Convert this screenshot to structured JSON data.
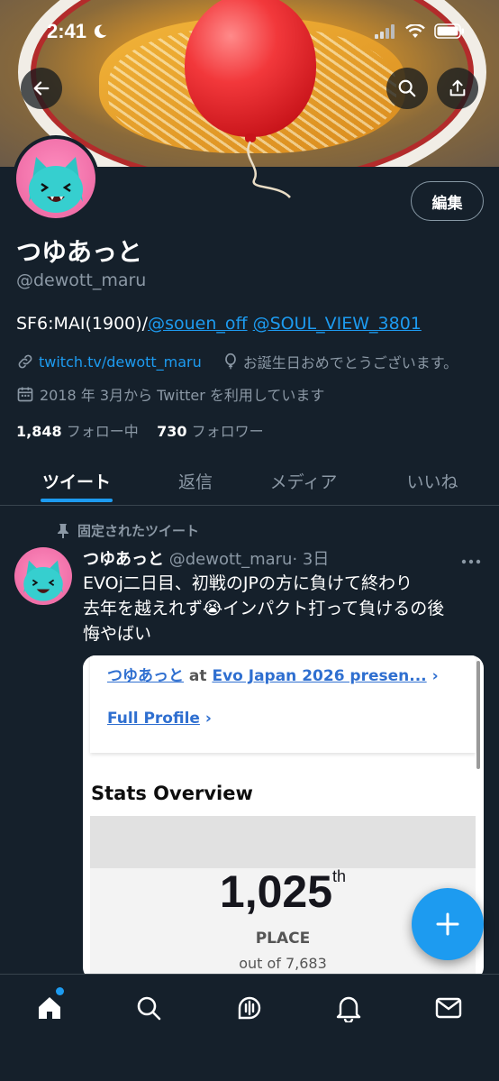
{
  "status_bar": {
    "time": "2:41"
  },
  "profile": {
    "display_name": "つゆあっと",
    "handle": "@dewott_maru",
    "edit_label": "編集",
    "bio_prefix": "SF6:MAI(1900)/",
    "bio_mention_1": "@souen_off",
    "bio_mention_2": "@SOUL_VIEW_3801",
    "website": "twitch.tv/dewott_maru",
    "birthday": "お誕生日おめでとうございます。",
    "joined": "2018 年 3月から Twitter を利用しています",
    "following_count": "1,848",
    "following_label": "フォロー中",
    "followers_count": "730",
    "followers_label": "フォロワー"
  },
  "tabs": [
    {
      "label": "ツイート",
      "active": true
    },
    {
      "label": "返信"
    },
    {
      "label": "メディア"
    },
    {
      "label": "いいね"
    }
  ],
  "tweet": {
    "pinned_label": "固定されたツイート",
    "author_name": "つゆあっと",
    "author_handle": "@dewott_maru",
    "time": "· 3日",
    "line1": "EVOj二日目、初戦のJPの方に負けて終わり",
    "line2": "去年を越えれず😭インパクト打って負けるの後",
    "line3": "悔やばい",
    "card": {
      "event_name": "つゆあっと",
      "event_at": "at",
      "event_title": "Evo Japan 2026 presen...",
      "full_profile": "Full Profile",
      "stats_title": "Stats Overview",
      "place_number": "1,025",
      "place_suffix": "th",
      "place_label": "PLACE",
      "place_out_of": "out of 7,683"
    }
  },
  "colors": {
    "background": "#15202b",
    "accent": "#1d9bf0",
    "secondary_text": "#8b98a5"
  },
  "icons": [
    "back-arrow-icon",
    "search-icon",
    "share-icon",
    "link-icon",
    "balloon-icon",
    "calendar-icon",
    "pin-icon",
    "more-icon",
    "compose-plus-icon",
    "home-icon",
    "explore-search-icon",
    "spaces-icon",
    "notifications-bell-icon",
    "messages-envelope-icon"
  ]
}
